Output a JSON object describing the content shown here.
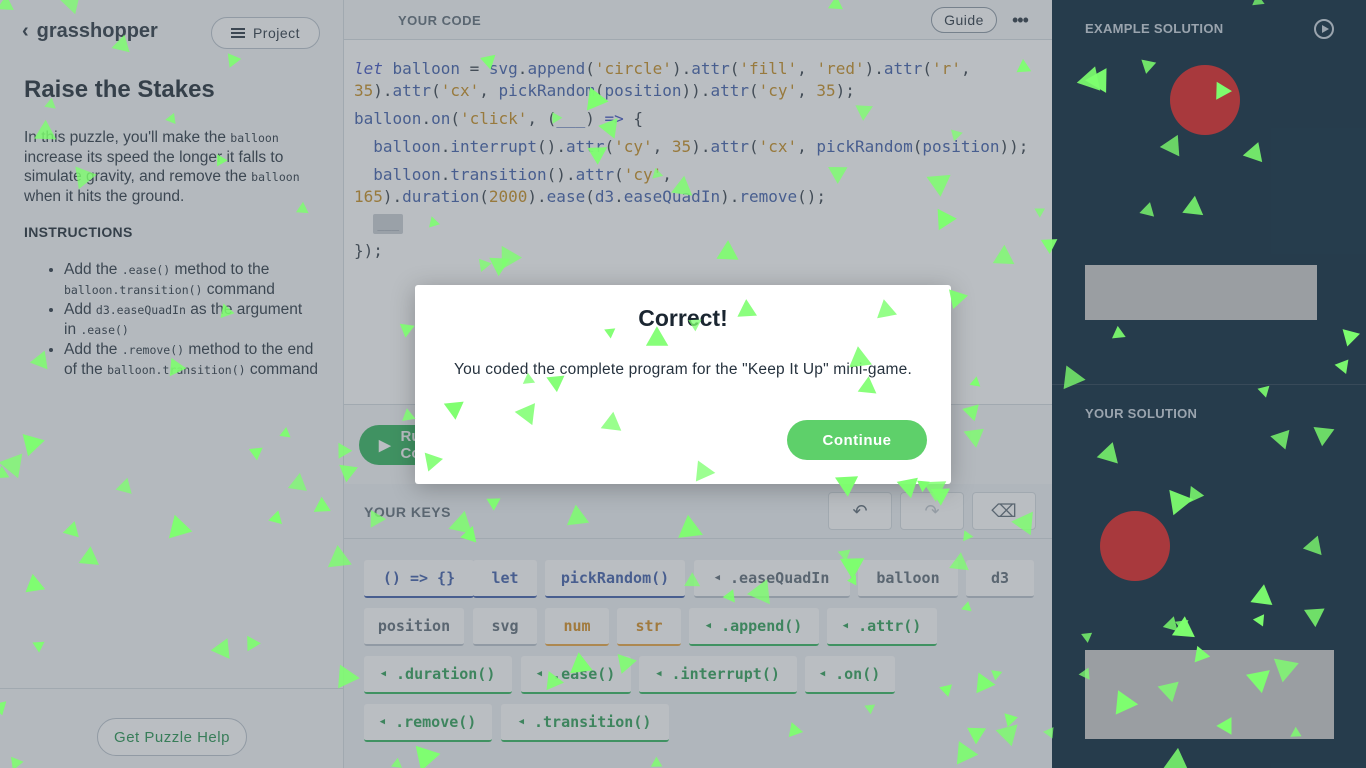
{
  "app": {
    "brand": "grasshopper",
    "project_label": "Project"
  },
  "puzzle": {
    "title": "Raise the Stakes",
    "intro": [
      {
        "t": "In this puzzle, you'll make the "
      },
      {
        "c": "balloon"
      },
      {
        "t": " increase its speed the longer it falls to simulate gravity, and remove the "
      },
      {
        "c": "balloon"
      },
      {
        "t": " when it hits the ground."
      }
    ],
    "instructions_title": "INSTRUCTIONS",
    "instructions": [
      [
        {
          "t": "Add the "
        },
        {
          "c": ".ease()"
        },
        {
          "t": " method to the "
        },
        {
          "c": "balloon.transition()"
        },
        {
          "t": " command"
        }
      ],
      [
        {
          "t": "Add "
        },
        {
          "c": "d3.easeQuadIn"
        },
        {
          "t": " as the argument in "
        },
        {
          "c": ".ease()"
        }
      ],
      [
        {
          "t": "Add the "
        },
        {
          "c": ".remove()"
        },
        {
          "t": " method to the end of the "
        },
        {
          "c": "balloon.transition()"
        },
        {
          "t": " command"
        }
      ]
    ],
    "help_label": "Get Puzzle Help"
  },
  "editor": {
    "header_label": "YOUR CODE",
    "guide_label": "Guide",
    "more_label": "•••",
    "lines": [
      [
        [
          "kw",
          "let"
        ],
        [
          "pun",
          " "
        ],
        [
          "var",
          "balloon"
        ],
        [
          "pun",
          " = "
        ],
        [
          "var",
          "svg"
        ],
        [
          "pun",
          "."
        ],
        [
          "fn",
          "append"
        ],
        [
          "pun",
          "("
        ],
        [
          "str",
          "'circle'"
        ],
        [
          "pun",
          ")."
        ],
        [
          "fn",
          "attr"
        ],
        [
          "pun",
          "("
        ],
        [
          "str",
          "'fill'"
        ],
        [
          "pun",
          ", "
        ],
        [
          "str",
          "'red'"
        ],
        [
          "pun",
          ")."
        ],
        [
          "fn",
          "attr"
        ],
        [
          "pun",
          "("
        ],
        [
          "str",
          "'r'"
        ],
        [
          "pun",
          ","
        ]
      ],
      [
        [
          "num",
          "35"
        ],
        [
          "pun",
          ")."
        ],
        [
          "fn",
          "attr"
        ],
        [
          "pun",
          "("
        ],
        [
          "str",
          "'cx'"
        ],
        [
          "pun",
          ", "
        ],
        [
          "fn",
          "pickRandom"
        ],
        [
          "pun",
          "("
        ],
        [
          "var",
          "position"
        ],
        [
          "pun",
          "))."
        ],
        [
          "fn",
          "attr"
        ],
        [
          "pun",
          "("
        ],
        [
          "str",
          "'cy'"
        ],
        [
          "pun",
          ", "
        ],
        [
          "num",
          "35"
        ],
        [
          "pun",
          ");"
        ]
      ],
      [
        [
          "var",
          "balloon"
        ],
        [
          "pun",
          "."
        ],
        [
          "fn",
          "on"
        ],
        [
          "pun",
          "("
        ],
        [
          "str",
          "'click'"
        ],
        [
          "pun",
          ", ("
        ],
        [
          "var",
          "___"
        ],
        [
          "pun",
          ") "
        ],
        [
          "kw",
          "=>"
        ],
        [
          "pun",
          " {"
        ]
      ],
      [
        [
          "pun",
          "  "
        ],
        [
          "var",
          "balloon"
        ],
        [
          "pun",
          "."
        ],
        [
          "fn",
          "interrupt"
        ],
        [
          "pun",
          "()."
        ],
        [
          "fn",
          "attr"
        ],
        [
          "pun",
          "("
        ],
        [
          "str",
          "'cy'"
        ],
        [
          "pun",
          ", "
        ],
        [
          "num",
          "35"
        ],
        [
          "pun",
          ")."
        ],
        [
          "fn",
          "attr"
        ],
        [
          "pun",
          "("
        ],
        [
          "str",
          "'cx'"
        ],
        [
          "pun",
          ", "
        ],
        [
          "fn",
          "pickRandom"
        ],
        [
          "pun",
          "("
        ],
        [
          "var",
          "position"
        ],
        [
          "pun",
          "));"
        ]
      ],
      [
        [
          "pun",
          "  "
        ],
        [
          "var",
          "balloon"
        ],
        [
          "pun",
          "."
        ],
        [
          "fn",
          "transition"
        ],
        [
          "pun",
          "()."
        ],
        [
          "fn",
          "attr"
        ],
        [
          "pun",
          "("
        ],
        [
          "str",
          "'cy'"
        ],
        [
          "pun",
          ","
        ]
      ],
      [
        [
          "num",
          "165"
        ],
        [
          "pun",
          ")."
        ],
        [
          "fn",
          "duration"
        ],
        [
          "pun",
          "("
        ],
        [
          "num",
          "2000"
        ],
        [
          "pun",
          ")."
        ],
        [
          "fn",
          "ease"
        ],
        [
          "pun",
          "("
        ],
        [
          "var",
          "d3"
        ],
        [
          "pun",
          "."
        ],
        [
          "var",
          "easeQuadIn"
        ],
        [
          "pun",
          ")."
        ],
        [
          "fn",
          "remove"
        ],
        [
          "pun",
          "();"
        ]
      ],
      [
        [
          "pun",
          "  "
        ],
        [
          "blank",
          "___"
        ]
      ],
      [
        [
          "pun",
          "});"
        ]
      ]
    ]
  },
  "run": {
    "label": "Run Code"
  },
  "keys": {
    "label": "YOUR KEYS",
    "items": [
      {
        "label": "() => {}",
        "color": "blue"
      },
      {
        "label": "let",
        "color": "blue"
      },
      {
        "label": "pickRandom()",
        "color": "blue"
      },
      {
        "label": ".easeQuadIn",
        "color": "gray",
        "tri": true
      },
      {
        "label": "balloon",
        "color": "gray"
      },
      {
        "label": "d3",
        "color": "gray"
      },
      {
        "label": "position",
        "color": "gray"
      },
      {
        "label": "svg",
        "color": "gray"
      },
      {
        "label": "num",
        "color": "orange"
      },
      {
        "label": "str",
        "color": "orange"
      },
      {
        "label": ".append()",
        "color": "green",
        "tri": true
      },
      {
        "label": ".attr()",
        "color": "green",
        "tri": true
      },
      {
        "label": ".duration()",
        "color": "green",
        "tri": true
      },
      {
        "label": ".ease()",
        "color": "green",
        "tri": true
      },
      {
        "label": ".interrupt()",
        "color": "green",
        "tri": true
      },
      {
        "label": ".on()",
        "color": "green",
        "tri": true
      },
      {
        "label": ".remove()",
        "color": "green",
        "tri": true
      },
      {
        "label": ".transition()",
        "color": "green",
        "tri": true
      }
    ]
  },
  "right": {
    "example_label": "EXAMPLE SOLUTION",
    "yours_label": "YOUR SOLUTION"
  },
  "modal": {
    "title": "Correct!",
    "message": "You coded the complete program for the \"Keep It Up\" mini-game.",
    "continue_label": "Continue"
  },
  "colors": {
    "accent_green": "#2eb45a",
    "continue_green": "#5ed06a",
    "right_bg": "#012035",
    "balloon": "#e01b1b",
    "confetti": "#7dff6e"
  }
}
